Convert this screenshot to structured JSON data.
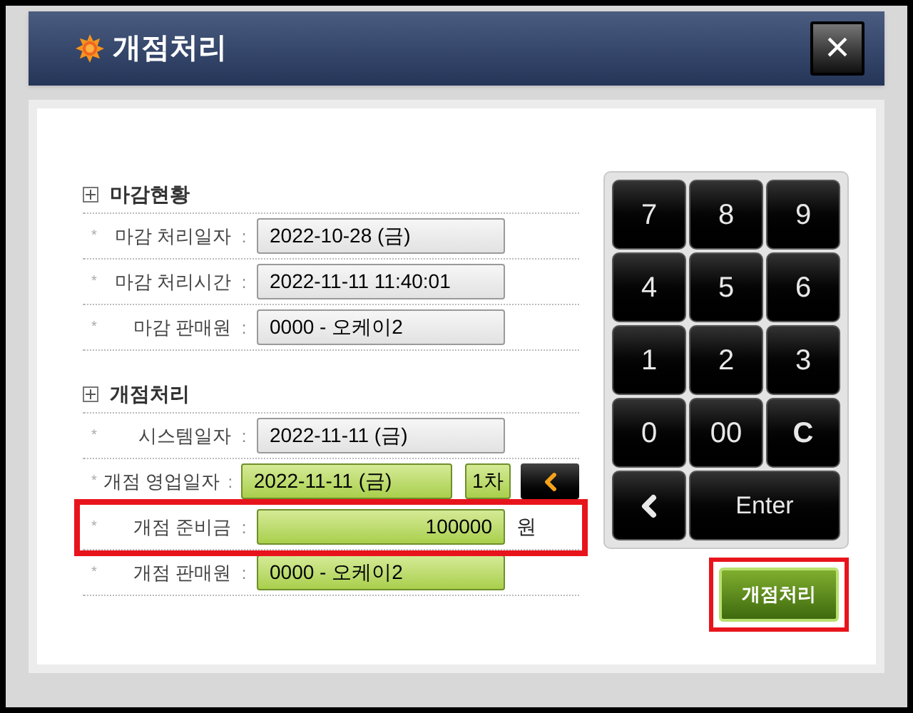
{
  "window": {
    "title": "개점처리",
    "close": "×"
  },
  "sections": [
    {
      "heading": "마감현황",
      "rows": [
        {
          "marker": "*",
          "label": "마감 처리일자",
          "colon": ":",
          "value": "2022-10-28 (금)",
          "kind": "plain",
          "highlighted": false
        },
        {
          "marker": "*",
          "label": "마감 처리시간",
          "colon": ":",
          "value": "2022-11-11 11:40:01",
          "kind": "plain",
          "highlighted": false
        },
        {
          "marker": "*",
          "label": "마감 판매원",
          "colon": ":",
          "value": "0000 - 오케이2",
          "kind": "plain",
          "highlighted": false
        }
      ]
    },
    {
      "heading": "개점처리",
      "rows": [
        {
          "marker": "*",
          "label": "시스템일자",
          "colon": ":",
          "value": "2022-11-11 (금)",
          "kind": "plain",
          "highlighted": false
        },
        {
          "marker": "*",
          "label": "개점 영업일자",
          "colon": ":",
          "value": "2022-11-11 (금)",
          "kind": "green",
          "round": "1차",
          "highlighted": false
        },
        {
          "marker": "*",
          "label": "개점 준비금",
          "colon": ":",
          "value": "100000",
          "kind": "amount",
          "unit": "원",
          "highlighted": true
        },
        {
          "marker": "*",
          "label": "개점 판매원",
          "colon": ":",
          "value": "0000 - 오케이2",
          "kind": "green",
          "highlighted": false
        }
      ]
    }
  ],
  "keypad": [
    {
      "kind": "key",
      "label": "7"
    },
    {
      "kind": "key",
      "label": "8"
    },
    {
      "kind": "key",
      "label": "9"
    },
    {
      "kind": "key",
      "label": "4"
    },
    {
      "kind": "key",
      "label": "5"
    },
    {
      "kind": "key",
      "label": "6"
    },
    {
      "kind": "key",
      "label": "1"
    },
    {
      "kind": "key",
      "label": "2"
    },
    {
      "kind": "key",
      "label": "3"
    },
    {
      "kind": "key",
      "label": "0"
    },
    {
      "kind": "key",
      "label": "00"
    },
    {
      "kind": "key",
      "label": "C"
    },
    {
      "kind": "back"
    },
    {
      "kind": "wide",
      "label": "Enter"
    }
  ],
  "submit": {
    "label": "개점처리",
    "highlighted": true
  }
}
